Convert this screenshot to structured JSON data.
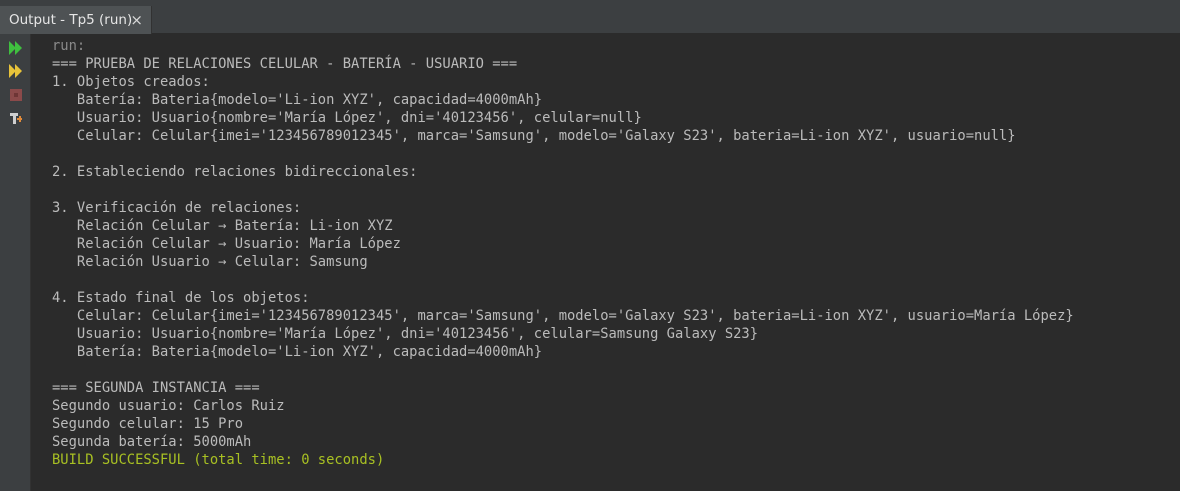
{
  "window": {
    "tab_title": "Output - Tp5 (run)",
    "close_glyph": "×"
  },
  "sidebar": {
    "buttons": [
      {
        "icon": "rerun-icon",
        "color": "#3fbf3f"
      },
      {
        "icon": "rerun-with-options-icon",
        "color": "#e8c33a"
      },
      {
        "icon": "stop-icon",
        "color": "#8b4a4a"
      },
      {
        "icon": "settings-icon",
        "color": "#cfcfcf"
      }
    ]
  },
  "console": {
    "lines": [
      "run:",
      "=== PRUEBA DE RELACIONES CELULAR - BATERÍA - USUARIO ===",
      "1. Objetos creados:",
      "   Batería: Bateria{modelo='Li-ion XYZ', capacidad=4000mAh}",
      "   Usuario: Usuario{nombre='María López', dni='40123456', celular=null}",
      "   Celular: Celular{imei='123456789012345', marca='Samsung', modelo='Galaxy S23', bateria=Li-ion XYZ', usuario=null}",
      "",
      "2. Estableciendo relaciones bidireccionales:",
      "",
      "3. Verificación de relaciones:",
      "   Relación Celular → Batería: Li-ion XYZ",
      "   Relación Celular → Usuario: María López",
      "   Relación Usuario → Celular: Samsung",
      "",
      "4. Estado final de los objetos:",
      "   Celular: Celular{imei='123456789012345', marca='Samsung', modelo='Galaxy S23', bateria=Li-ion XYZ', usuario=María López}",
      "   Usuario: Usuario{nombre='María López', dni='40123456', celular=Samsung Galaxy S23}",
      "   Batería: Bateria{modelo='Li-ion XYZ', capacidad=4000mAh}",
      "",
      "=== SEGUNDA INSTANCIA ===",
      "Segundo usuario: Carlos Ruiz",
      "Segundo celular: 15 Pro",
      "Segunda batería: 5000mAh",
      "BUILD SUCCESSFUL (total time: 0 seconds)"
    ]
  }
}
